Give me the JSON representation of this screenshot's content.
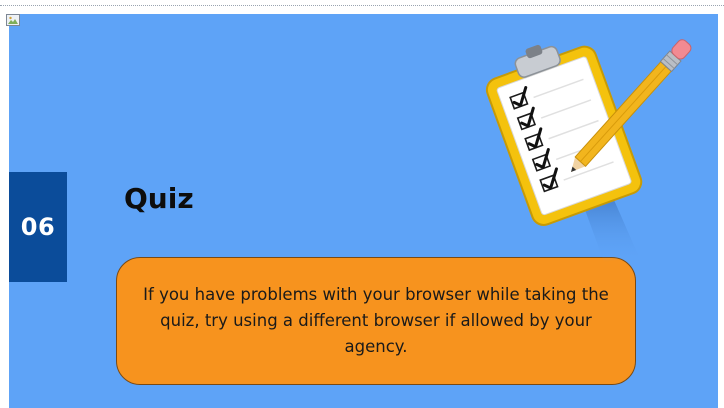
{
  "slide": {
    "section_number": "06",
    "title": "Quiz",
    "callout_text": "If you have problems with your browser while taking the quiz, try using a different browser if allowed by your agency."
  },
  "icons": {
    "broken_image": "broken-image-icon",
    "illustration": "clipboard-checklist-pencil"
  },
  "colors": {
    "slide_background": "#5ea3f7",
    "badge": "#0b4c9a",
    "callout": "#f7931e",
    "clipboard": "#f4c20d",
    "pencil": "#f2b51d"
  }
}
